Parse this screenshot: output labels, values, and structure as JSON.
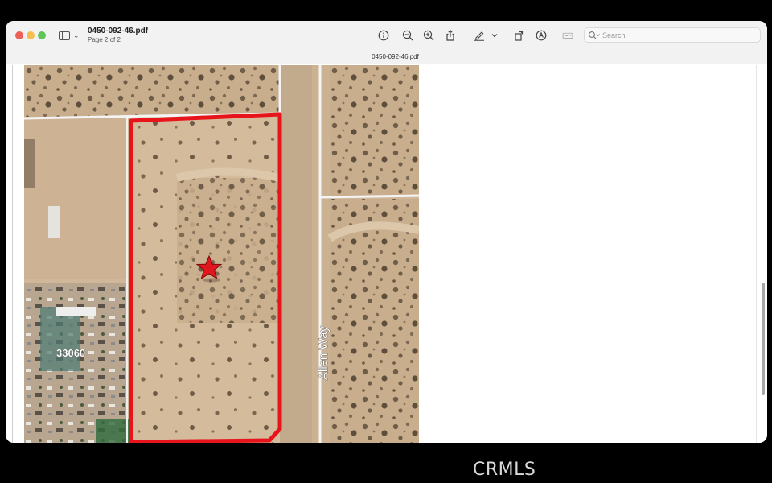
{
  "window": {
    "title": "0450-092-46.pdf",
    "subtitle": "Page 2 of 2",
    "tab_label": "0450-092-46.pdf"
  },
  "toolbar": {
    "icons": [
      "sidebar-icon",
      "info-icon",
      "zoom-out-icon",
      "zoom-in-icon",
      "share-icon",
      "highlight-pen-icon",
      "chevron-down-icon",
      "rotate-icon",
      "markup-icon",
      "signature-icon"
    ],
    "search_placeholder": "Search"
  },
  "map": {
    "parcel_number": "33060",
    "street_label": "Allen Way",
    "boundary_color": "#e8141c",
    "marker_color": "#e0171f"
  },
  "watermark": "CRMLS"
}
